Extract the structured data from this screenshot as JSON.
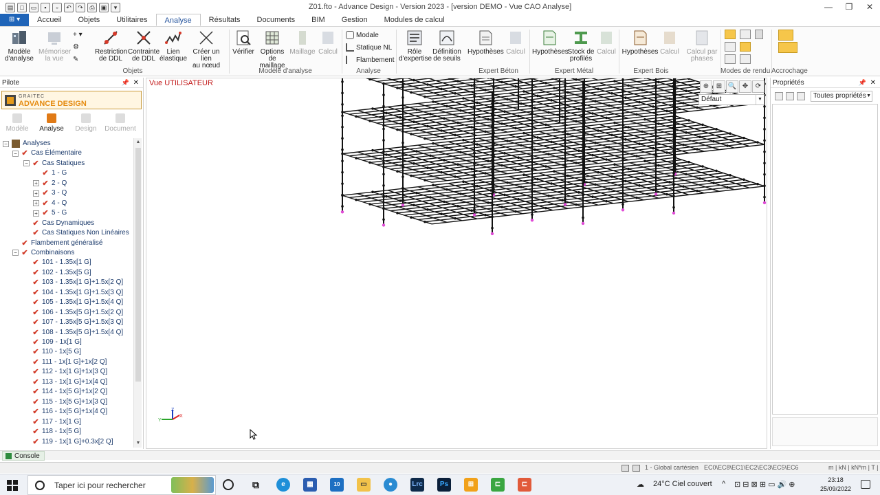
{
  "window": {
    "title": "Z01.fto - Advance Design - Version 2023 - [version DEMO - Vue CAO Analyse]",
    "controls": {
      "minimize": "—",
      "restore": "❐",
      "close": "✕"
    }
  },
  "ribbon_tabs": [
    "Accueil",
    "Objets",
    "Utilitaires",
    "Analyse",
    "Résultats",
    "Documents",
    "BIM",
    "Gestion",
    "Modules de calcul"
  ],
  "active_tab": "Analyse",
  "ribbon": {
    "objets": {
      "group_label": "Objets",
      "modele": "Modèle\nd'analyse",
      "memoriser": "Mémoriser\nla vue",
      "restriction": "Restriction\nde DDL",
      "contrainte": "Contrainte\nde DDL",
      "lien_elastique": "Lien\nélastique",
      "creer_lien": "Créer un lien\nau nœud"
    },
    "modele_analyse": {
      "group_label": "Modèle d'analyse",
      "verifier": "Vérifier",
      "options": "Options de\nmaillage",
      "maillage": "Maillage",
      "calcul": "Calcul"
    },
    "analyse": {
      "group_label": "Analyse",
      "modale": "Modale",
      "statique_nl": "Statique NL",
      "flambement": "Flambement"
    },
    "expert_beton": {
      "group_label": "Expert Béton",
      "role": "Rôle\nd'expertise",
      "seuils": "Définition\nde seuils",
      "hypotheses": "Hypothèses",
      "calcul": "Calcul"
    },
    "expert_metal": {
      "group_label": "Expert Métal",
      "hypotheses": "Hypothèses",
      "stock": "Stock de\nprofilés",
      "calcul": "Calcul"
    },
    "expert_bois": {
      "group_label": "Expert Bois",
      "hypotheses": "Hypothèses",
      "calcul": "Calcul",
      "calcul_phases": "Calcul par\nphases"
    },
    "modes_rendu": {
      "group_label": "Modes de rendu"
    },
    "accrochage": {
      "group_label": "Accrochage"
    }
  },
  "pilote": {
    "title": "Pilote",
    "brand_line1": "GRAITEC",
    "brand_line2": "ADVANCE DESIGN",
    "modes": [
      {
        "label": "Modèle",
        "active": false
      },
      {
        "label": "Analyse",
        "active": true
      },
      {
        "label": "Design",
        "active": false
      },
      {
        "label": "Document",
        "active": false
      }
    ],
    "tree": [
      {
        "label": "Analyses",
        "level": 0,
        "expander": "⊟",
        "kind": "root"
      },
      {
        "label": "Cas Élémentaire",
        "level": 1,
        "expander": "⊟",
        "kind": "check"
      },
      {
        "label": "Cas Statiques",
        "level": 2,
        "expander": "⊟",
        "kind": "check"
      },
      {
        "label": "1 - G",
        "level": 3,
        "expander": "",
        "kind": "check"
      },
      {
        "label": "2 - Q",
        "level": 3,
        "expander": "⊞",
        "kind": "check"
      },
      {
        "label": "3 - Q",
        "level": 3,
        "expander": "⊞",
        "kind": "check"
      },
      {
        "label": "4 - Q",
        "level": 3,
        "expander": "⊞",
        "kind": "check"
      },
      {
        "label": "5 - G",
        "level": 3,
        "expander": "⊞",
        "kind": "check"
      },
      {
        "label": "Cas Dynamiques",
        "level": 2,
        "expander": "",
        "kind": "check"
      },
      {
        "label": "Cas Statiques Non Linéaires",
        "level": 2,
        "expander": "",
        "kind": "check"
      },
      {
        "label": "Flambement généralisé",
        "level": 1,
        "expander": "",
        "kind": "check"
      },
      {
        "label": "Combinaisons",
        "level": 1,
        "expander": "⊟",
        "kind": "check"
      },
      {
        "label": "101 - 1.35x[1 G]",
        "level": 2,
        "expander": "",
        "kind": "check"
      },
      {
        "label": "102 - 1.35x[5 G]",
        "level": 2,
        "expander": "",
        "kind": "check"
      },
      {
        "label": "103 - 1.35x[1 G]+1.5x[2 Q]",
        "level": 2,
        "expander": "",
        "kind": "check"
      },
      {
        "label": "104 - 1.35x[1 G]+1.5x[3 Q]",
        "level": 2,
        "expander": "",
        "kind": "check"
      },
      {
        "label": "105 - 1.35x[1 G]+1.5x[4 Q]",
        "level": 2,
        "expander": "",
        "kind": "check"
      },
      {
        "label": "106 - 1.35x[5 G]+1.5x[2 Q]",
        "level": 2,
        "expander": "",
        "kind": "check"
      },
      {
        "label": "107 - 1.35x[5 G]+1.5x[3 Q]",
        "level": 2,
        "expander": "",
        "kind": "check"
      },
      {
        "label": "108 - 1.35x[5 G]+1.5x[4 Q]",
        "level": 2,
        "expander": "",
        "kind": "check"
      },
      {
        "label": "109 - 1x[1 G]",
        "level": 2,
        "expander": "",
        "kind": "check"
      },
      {
        "label": "110 - 1x[5 G]",
        "level": 2,
        "expander": "",
        "kind": "check"
      },
      {
        "label": "111 - 1x[1 G]+1x[2 Q]",
        "level": 2,
        "expander": "",
        "kind": "check"
      },
      {
        "label": "112 - 1x[1 G]+1x[3 Q]",
        "level": 2,
        "expander": "",
        "kind": "check"
      },
      {
        "label": "113 - 1x[1 G]+1x[4 Q]",
        "level": 2,
        "expander": "",
        "kind": "check"
      },
      {
        "label": "114 - 1x[5 G]+1x[2 Q]",
        "level": 2,
        "expander": "",
        "kind": "check"
      },
      {
        "label": "115 - 1x[5 G]+1x[3 Q]",
        "level": 2,
        "expander": "",
        "kind": "check"
      },
      {
        "label": "116 - 1x[5 G]+1x[4 Q]",
        "level": 2,
        "expander": "",
        "kind": "check"
      },
      {
        "label": "117 - 1x[1 G]",
        "level": 2,
        "expander": "",
        "kind": "check"
      },
      {
        "label": "118 - 1x[5 G]",
        "level": 2,
        "expander": "",
        "kind": "check"
      },
      {
        "label": "119 - 1x[1 G]+0.3x[2 Q]",
        "level": 2,
        "expander": "",
        "kind": "check"
      }
    ]
  },
  "viewport": {
    "title": "Vue UTILISATEUR",
    "view_select": "Défaut",
    "axis_labels": {
      "x": "X",
      "y": "Y",
      "z": "Z"
    }
  },
  "properties": {
    "title": "Propriétés",
    "filter": "Toutes propriétés"
  },
  "console": {
    "label": "Console"
  },
  "status": {
    "coord_system": "1 - Global cartésien",
    "norms": "EC0\\EC8\\EC1\\EC2\\EC3\\EC5\\EC6",
    "units": "m | kN | kN*m | T | T:"
  },
  "taskbar": {
    "search_placeholder": "Taper ici pour rechercher",
    "mail_badge": "10",
    "app_lrc": "Lrc",
    "app_ps": "Ps",
    "weather": "24°C  Ciel couvert",
    "time": "23:18",
    "date": "25/09/2022"
  },
  "colors": {
    "accent": "#1f64b8",
    "brand_orange": "#e58b10",
    "view_title": "#c21818",
    "support_pink": "#e04ad6",
    "tree_check": "#d23c2a"
  }
}
